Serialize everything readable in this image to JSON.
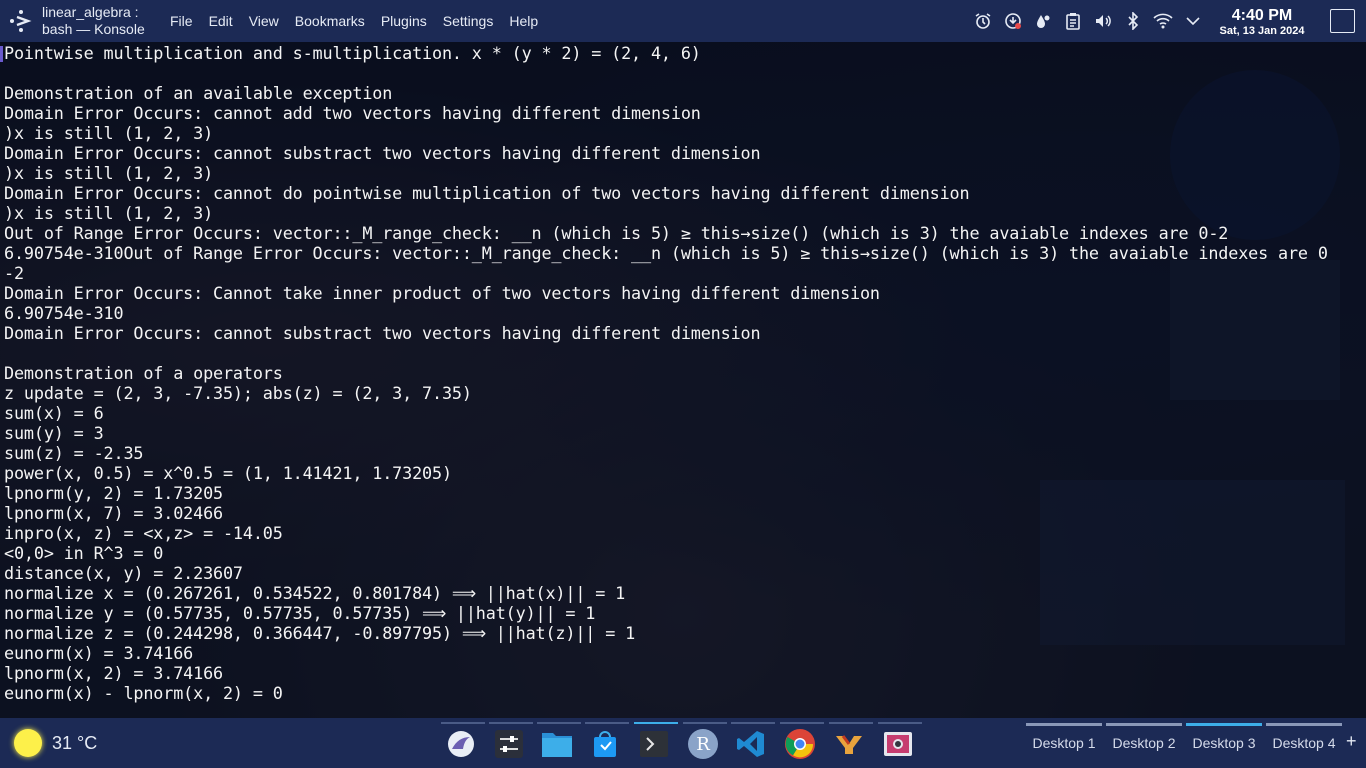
{
  "window": {
    "title_line1": "linear_algebra :",
    "title_line2": "bash — Konsole"
  },
  "menu": [
    "File",
    "Edit",
    "View",
    "Bookmarks",
    "Plugins",
    "Settings",
    "Help"
  ],
  "tray": {
    "icons": [
      "alarm-icon",
      "updates-icon",
      "weather-drops-icon",
      "clipboard-icon",
      "volume-icon",
      "bluetooth-icon",
      "wifi-icon",
      "chevron-down-icon"
    ]
  },
  "clock": {
    "time": "4:40 PM",
    "date": "Sat, 13 Jan 2024"
  },
  "terminal": {
    "lines": [
      "Pointwise multiplication and s-multiplication. x * (y * 2) = (2, 4, 6)",
      "",
      "Demonstration of an available exception",
      "Domain Error Occurs: cannot add two vectors having different dimension",
      ")x is still (1, 2, 3)",
      "Domain Error Occurs: cannot substract two vectors having different dimension",
      ")x is still (1, 2, 3)",
      "Domain Error Occurs: cannot do pointwise multiplication of two vectors having different dimension",
      ")x is still (1, 2, 3)",
      "Out of Range Error Occurs: vector::_M_range_check: __n (which is 5) ≥ this→size() (which is 3) the avaiable indexes are 0-2",
      "6.90754e-310Out of Range Error Occurs: vector::_M_range_check: __n (which is 5) ≥ this→size() (which is 3) the avaiable indexes are 0",
      "-2",
      "Domain Error Occurs: Cannot take inner product of two vectors having different dimension",
      "6.90754e-310",
      "Domain Error Occurs: cannot substract two vectors having different dimension",
      "",
      "Demonstration of a operators",
      "z update = (2, 3, -7.35); abs(z) = (2, 3, 7.35)",
      "sum(x) = 6",
      "sum(y) = 3",
      "sum(z) = -2.35",
      "power(x, 0.5) = x^0.5 = (1, 1.41421, 1.73205)",
      "lpnorm(y, 2) = 1.73205",
      "lpnorm(x, 7) = 3.02466",
      "inpro(x, z) = <x,z> = -14.05",
      "<0,0> in R^3 = 0",
      "distance(x, y) = 2.23607",
      "normalize x = (0.267261, 0.534522, 0.801784) ⟹ ||hat(x)|| = 1",
      "normalize y = (0.57735, 0.57735, 0.57735) ⟹ ||hat(y)|| = 1",
      "normalize z = (0.244298, 0.366447, -0.897795) ⟹ ||hat(z)|| = 1",
      "eunorm(x) = 3.74166",
      "lpnorm(x, 2) = 3.74166",
      "eunorm(x) - lpnorm(x, 2) = 0"
    ]
  },
  "taskbar": {
    "weather": {
      "temp": "31 °C",
      "icon": "sun-icon"
    },
    "tasks": [
      {
        "name": "kdeconnect-icon",
        "active": false
      },
      {
        "name": "mixer-icon",
        "active": false
      },
      {
        "name": "file-manager-icon",
        "active": false
      },
      {
        "name": "store-icon",
        "active": false
      },
      {
        "name": "konsole-icon",
        "active": true
      },
      {
        "name": "r-icon",
        "active": false
      },
      {
        "name": "vscode-icon",
        "active": false
      },
      {
        "name": "chrome-icon",
        "active": false
      },
      {
        "name": "yakuake-icon",
        "active": false
      },
      {
        "name": "screenshot-icon",
        "active": false
      }
    ],
    "desktops": [
      "Desktop 1",
      "Desktop 2",
      "Desktop 3",
      "Desktop 4"
    ],
    "active_desktop": "Desktop 3",
    "add_label": "+"
  },
  "colors": {
    "panel": "#1c2a55",
    "accent": "#3daee9",
    "terminal_text": "#f4f4f4"
  }
}
